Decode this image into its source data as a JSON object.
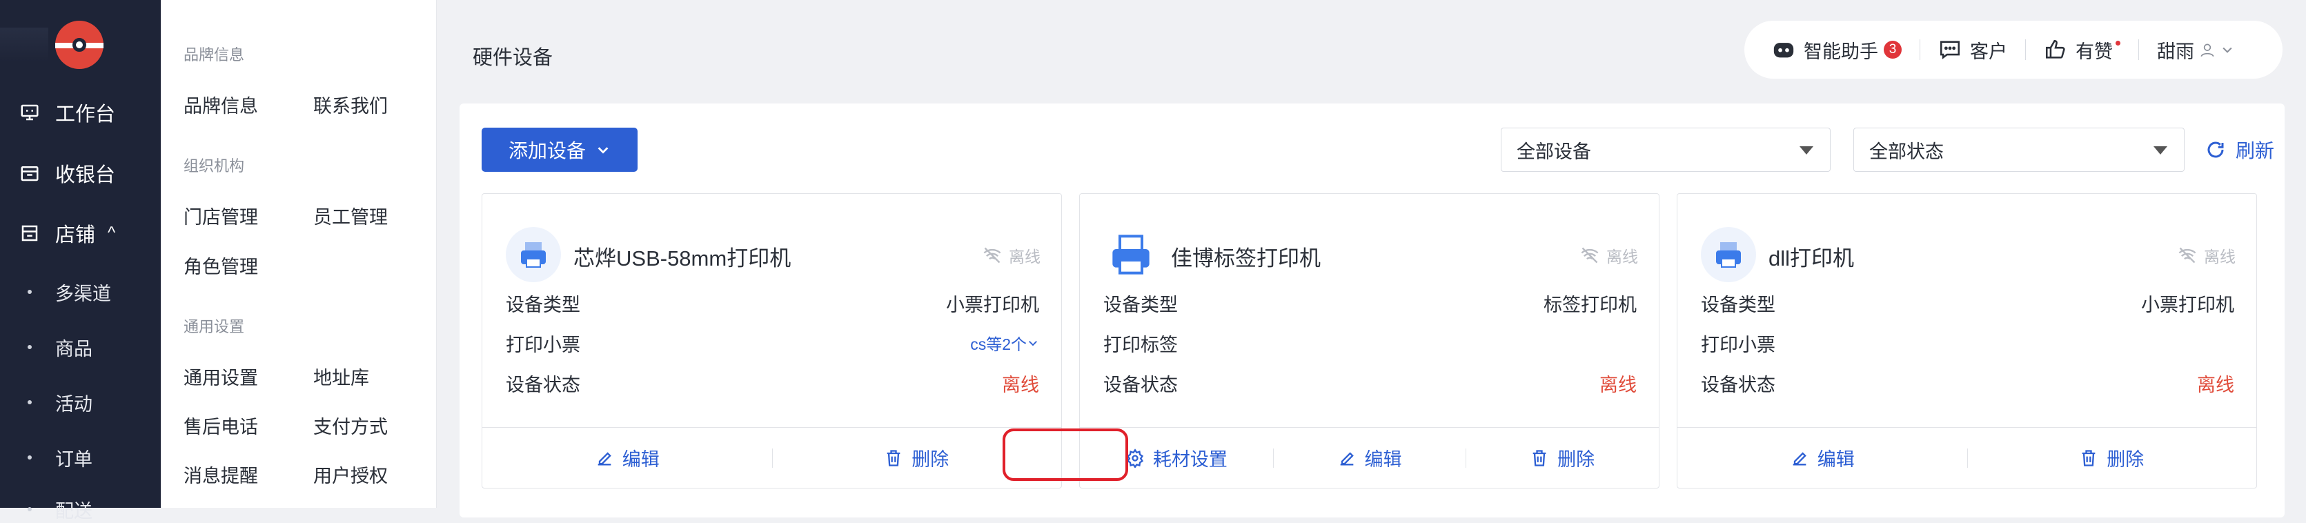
{
  "sidebar": {
    "items": [
      {
        "label": "工作台",
        "icon": "monitor-icon"
      },
      {
        "label": "收银台",
        "icon": "cash-register-icon"
      },
      {
        "label": "店铺",
        "icon": "store-icon",
        "expanded": true
      }
    ],
    "sub_items": [
      "多渠道",
      "商品",
      "活动",
      "订单",
      "配送"
    ],
    "store_caret": "^"
  },
  "submenu": {
    "sections": [
      {
        "title": "品牌信息",
        "links": [
          "品牌信息",
          "联系我们"
        ]
      },
      {
        "title": "组织机构",
        "links": [
          "门店管理",
          "员工管理",
          "角色管理"
        ]
      },
      {
        "title": "通用设置",
        "links": [
          "通用设置",
          "地址库",
          "售后电话",
          "支付方式",
          "消息提醒",
          "用户授权"
        ]
      }
    ]
  },
  "page": {
    "title": "硬件设备"
  },
  "topbar": {
    "assistant_label": "智能助手",
    "assistant_badge": "3",
    "customer_label": "客户",
    "like_label": "有赞",
    "user_label": "甜雨"
  },
  "toolbar": {
    "add_label": "添加设备",
    "device_filter": "全部设备",
    "status_filter": "全部状态",
    "refresh_label": "刷新"
  },
  "cards": [
    {
      "name": "芯烨USB-58mm打印机",
      "status": "离线",
      "rows": [
        {
          "label": "设备类型",
          "value": "小票打印机"
        },
        {
          "label": "打印小票",
          "value": "cs等2个"
        },
        {
          "label": "设备状态",
          "value": "离线"
        }
      ],
      "actions": [
        "编辑",
        "删除"
      ]
    },
    {
      "name": "佳博标签打印机",
      "status": "离线",
      "rows": [
        {
          "label": "设备类型",
          "value": "标签打印机"
        },
        {
          "label": "打印标签",
          "value": ""
        },
        {
          "label": "设备状态",
          "value": "离线"
        }
      ],
      "actions": [
        "耗材设置",
        "编辑",
        "删除"
      ]
    },
    {
      "name": "dll打印机",
      "status": "离线",
      "rows": [
        {
          "label": "设备类型",
          "value": "小票打印机"
        },
        {
          "label": "打印小票",
          "value": ""
        },
        {
          "label": "设备状态",
          "value": "离线"
        }
      ],
      "actions": [
        "编辑",
        "删除"
      ]
    }
  ],
  "colors": {
    "primary": "#2d5fd3",
    "sidebar_bg": "#1e2437",
    "offline_red": "#e04b3a",
    "highlight": "#e0202a"
  }
}
